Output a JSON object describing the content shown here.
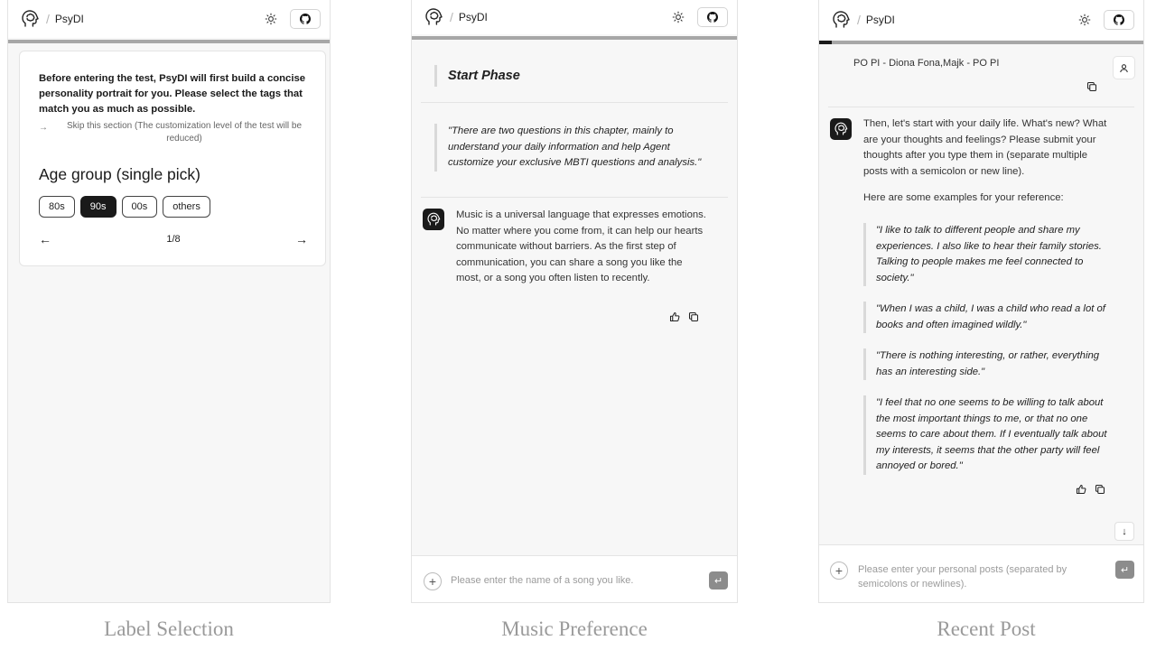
{
  "app": {
    "brand": "PsyDI",
    "separator": "/",
    "icons": {
      "logo": "brain-head-icon",
      "theme": "sun-icon",
      "repo": "github-icon",
      "add": "plus-icon",
      "send": "enter-icon",
      "prev": "arrow-left-icon",
      "next": "arrow-right-icon",
      "like": "thumbs-up-icon",
      "copy": "copy-icon",
      "user": "user-icon",
      "scroll": "arrow-down-icon"
    },
    "colors": {
      "accent": "#1a1a1a",
      "progress_track": "#a7a7a7",
      "panel_bg": "#f7f7f7",
      "caption": "#9a9a9a"
    }
  },
  "captions": [
    "Label Selection",
    "Music Preference",
    "Recent Post"
  ],
  "label_selection": {
    "progress": 0,
    "intro": "Before entering the test, PsyDI will first build a concise personality portrait for you. Please select the tags that match you as much as possible.",
    "skip_arrow": "→",
    "skip_text": "Skip this section (The customization level of the test will be reduced)",
    "question": "Age group (single pick)",
    "options": [
      "80s",
      "90s",
      "00s",
      "others"
    ],
    "selected": "90s",
    "prev": "←",
    "next": "→",
    "page": "1/8"
  },
  "music_preference": {
    "progress": 0,
    "phase_title": "Start Phase",
    "phase_quote": "\"There are two questions in this chapter, mainly to understand your daily information and help Agent customize your exclusive MBTI questions and analysis.\"",
    "agent_message": "Music is a universal language that expresses emotions. No matter where you come from, it can help our hearts communicate without barriers. As the first step of communication, you can share a song you like the most, or a song you often listen to recently.",
    "input_placeholder": "Please enter the name of a song you like.",
    "add_symbol": "+",
    "send_symbol": "↵"
  },
  "recent_post": {
    "progress": 0.04,
    "user_message": "PO PI - Diona Fona,Majk - PO PI",
    "agent_message": "Then, let's start with your daily life. What's new? What are your thoughts and feelings? Please submit your thoughts after you type them in (separate multiple posts with a semicolon or new line).",
    "examples_intro": "Here are some examples for your reference:",
    "examples": [
      "\"I like to talk to different people and share my experiences. I also like to hear their family stories. Talking to people makes me feel connected to society.\"",
      "\"When I was a child, I was a child who read a lot of books and often imagined wildly.\"",
      "\"There is nothing interesting, or rather, everything has an interesting side.\"",
      "\"I feel that no one seems to be willing to talk about the most important things to me, or that no one seems to care about them. If I eventually talk about my interests, it seems that the other party will feel annoyed or bored.\""
    ],
    "input_placeholder": "Please enter your personal posts (separated by semicolons or newlines).",
    "add_symbol": "+",
    "send_symbol": "↵",
    "scroll_symbol": "↓"
  }
}
